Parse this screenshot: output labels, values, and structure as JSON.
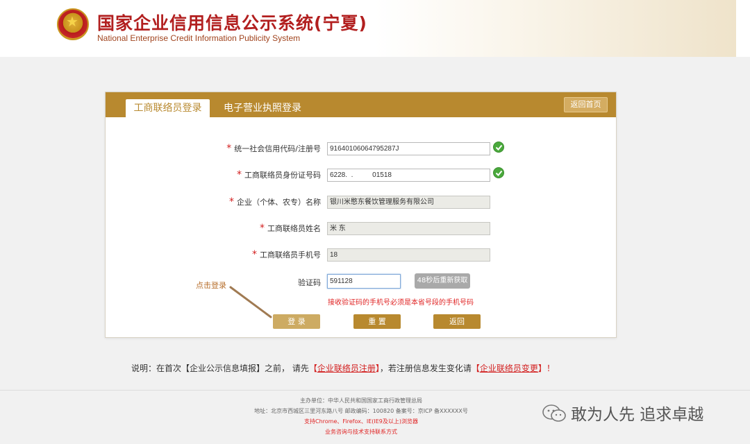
{
  "header": {
    "title": "国家企业信用信息公示系统",
    "region": "(宁夏)",
    "subtitle": "National Enterprise Credit Information Publicity System"
  },
  "tabs": {
    "active": "工商联络员登录",
    "inactive": "电子营业执照登录",
    "home": "返回首页"
  },
  "form": {
    "credit_code": {
      "label": "统一社会信用代码/注册号",
      "value": "91640106064795287J"
    },
    "id_number": {
      "label": "工商联络员身份证号码",
      "value": "6228.  .          01518"
    },
    "company_name": {
      "label": "企业（个体、农专）名称",
      "value": "银川米愍东餐饮管理服务有限公司"
    },
    "contact_name": {
      "label": "工商联络员姓名",
      "value": "米  东"
    },
    "phone": {
      "label": "工商联络员手机号",
      "value": "18"
    },
    "verify_code": {
      "label": "验证码",
      "value": "591128"
    },
    "resend": "48秒后重新获取",
    "hint": "接收验证码的手机号必须是本省号段的手机号码"
  },
  "buttons": {
    "login": "登 录",
    "reset": "重 置",
    "back": "返回"
  },
  "annotation": "点击登录",
  "notice": {
    "prefix": "说明：在首次【企业公示信息填报】之前， 请先",
    "register_link": "企业联络员注册",
    "middle": "，若注册信息发生变化请",
    "change_link": "企业联络员变更",
    "suffix": "！"
  },
  "footer": {
    "line1": "主办单位：中华人民共和国国家工商行政管理总局",
    "line2": "地址：北京市西城区三里河东路八号 邮政编码：100820 备案号：京ICP 备XXXXXX号",
    "line3": "支持Chrome、Firefox、IE(IE9及以上)浏览器",
    "line4": "业务咨询与技术支持联系方式"
  },
  "watermark": "敢为人先 追求卓越",
  "colors": {
    "brand_gold": "#b8892f",
    "title_red": "#b21f1f",
    "alert_red": "#e02424"
  }
}
